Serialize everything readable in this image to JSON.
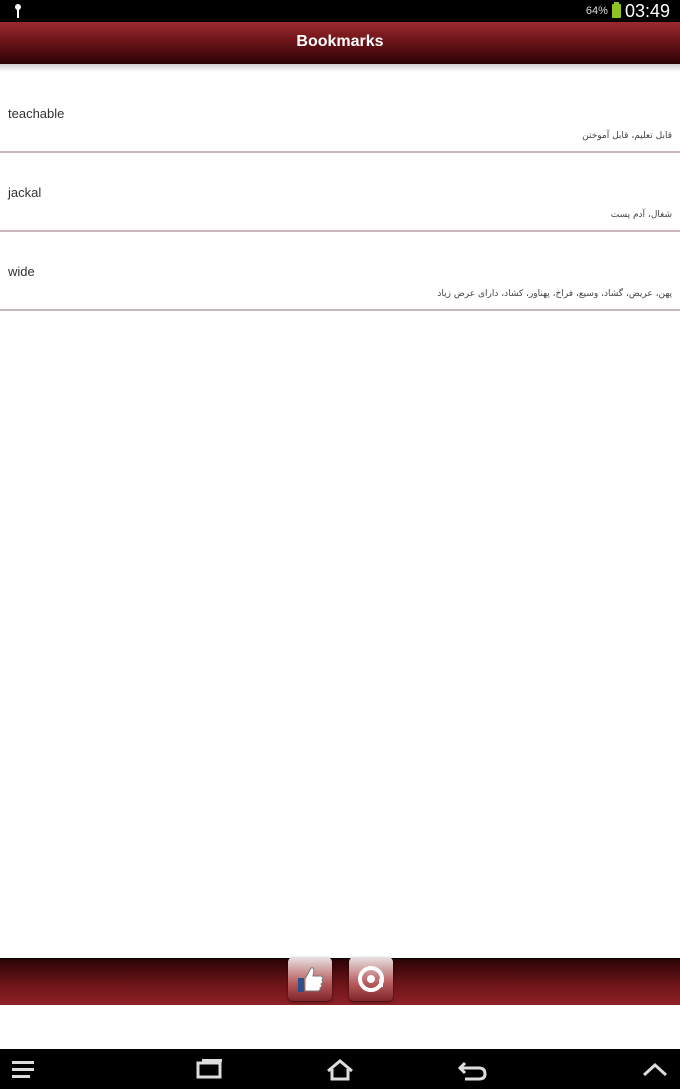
{
  "status_bar": {
    "battery_text": "64%",
    "time": "03:49",
    "icons": [
      "usb-icon",
      "battery-icon"
    ]
  },
  "header": {
    "title": "Bookmarks"
  },
  "bookmarks": [
    {
      "word": "teachable",
      "meaning": "قابل تعلیم، قابل آموختن"
    },
    {
      "word": "jackal",
      "meaning": "شغال، آدم پست"
    },
    {
      "word": "wide",
      "meaning": "پهن، عریض، گشاد، وسیع، فراخ، پهناور، کشاد، دارای عرض زیاد"
    }
  ],
  "toolbar": {
    "buttons": [
      "like-icon",
      "share-icon"
    ]
  },
  "nav_bar": {
    "icons": [
      "menu-icon",
      "recent-apps-icon",
      "home-icon",
      "back-icon",
      "chevron-up-icon"
    ]
  },
  "colors": {
    "accent_dark": "#2b0305",
    "accent": "#6d1419",
    "accent_light": "#9a2a2e",
    "divider": "#c9b7b9"
  }
}
